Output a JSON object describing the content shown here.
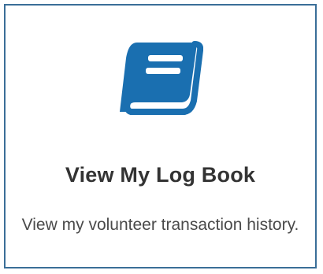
{
  "card": {
    "icon": "log-book-icon",
    "title": "View My Log Book",
    "description": "View my volunteer transaction history.",
    "colors": {
      "border": "#3a6e98",
      "icon": "#1a6fb0",
      "title": "#333333",
      "description": "#4a4a4a"
    }
  }
}
